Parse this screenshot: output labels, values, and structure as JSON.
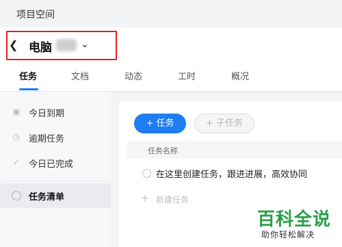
{
  "topbar": {
    "title": "项目空间"
  },
  "header": {
    "project_name": "电脑"
  },
  "tabs": [
    {
      "label": "任务"
    },
    {
      "label": "文档"
    },
    {
      "label": "动态"
    },
    {
      "label": "工时"
    },
    {
      "label": "概况"
    }
  ],
  "sidebar": {
    "items": [
      {
        "label": "今日到期",
        "icon": "calendar-icon"
      },
      {
        "label": "逾期任务",
        "icon": "clock-icon"
      },
      {
        "label": "今日已完成",
        "icon": "check-circle-icon"
      },
      {
        "label": "任务清单",
        "icon": "circle-icon"
      }
    ]
  },
  "toolbar": {
    "task_button": "+ 任务",
    "subtask_button": "+ 子任务"
  },
  "table": {
    "header": "任务名称",
    "rows": [
      "在这里创建任务，跟进进展，高效协同"
    ],
    "new_task": "新建任务"
  },
  "watermark": {
    "title": "百科全说",
    "subtitle": "助你轻松解决"
  },
  "colors": {
    "accent": "#1f7df2",
    "highlight_box": "#e41e1e",
    "watermark_green": "#2a9e46"
  }
}
